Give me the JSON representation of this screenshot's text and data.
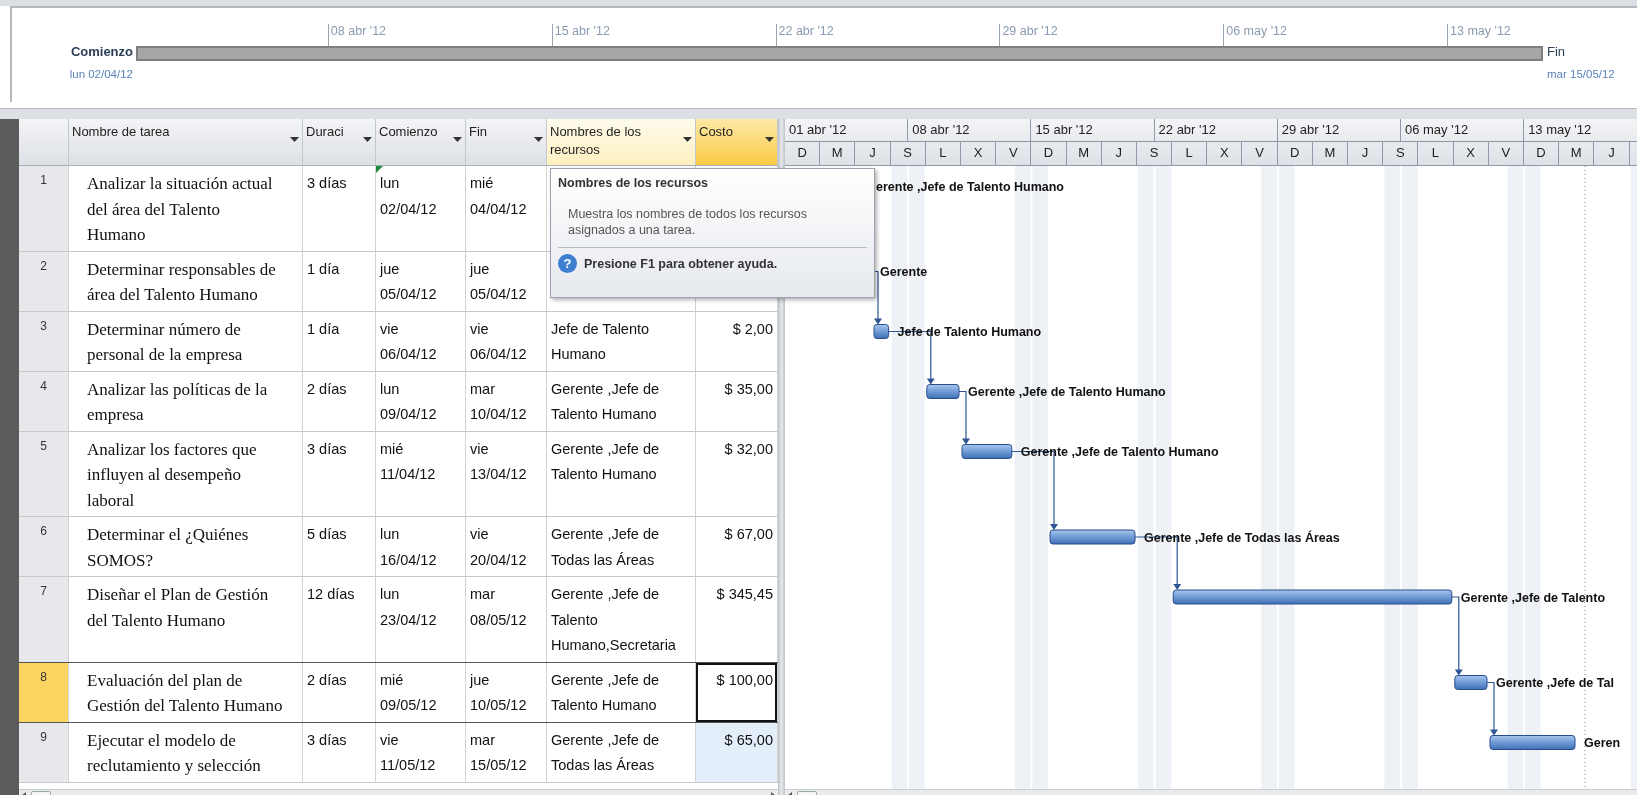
{
  "timeline": {
    "start_label": "Comienzo",
    "start_date": "lun 02/04/12",
    "end_label": "Fin",
    "end_date": "mar 15/05/12",
    "ticks": [
      "08 abr '12",
      "15 abr '12",
      "22 abr '12",
      "29 abr '12",
      "06 may '12",
      "13 may '12"
    ]
  },
  "table": {
    "columns": [
      {
        "label": "Nombre de tarea",
        "selected": false,
        "hovered": false
      },
      {
        "label": "Duraci",
        "selected": false,
        "hovered": false
      },
      {
        "label": "Comienzo",
        "selected": false,
        "hovered": false
      },
      {
        "label": "Fin",
        "selected": false,
        "hovered": false
      },
      {
        "label": "Nombres de los recursos",
        "selected": false,
        "hovered": true
      },
      {
        "label": "Costo",
        "selected": true,
        "hovered": false
      }
    ],
    "rows": [
      {
        "id": "1",
        "name": "Analizar la situación actual\ndel área del Talento\nHumano",
        "duration": "3 días",
        "start": "lun 02/04/12",
        "finish": "mié 04/04/12",
        "start_flag": true,
        "selected": false,
        "cost_active": false,
        "cost_highlighted": false,
        "bar_label": "erente ,Jefe de Talento Humano"
      },
      {
        "id": "2",
        "name": "Determinar responsables de\nárea del Talento Humano",
        "duration": "1 día",
        "start": "jue 05/04/12",
        "finish": "jue 05/04/12",
        "start_flag": false,
        "selected": false,
        "cost_active": false,
        "cost_highlighted": false,
        "bar_label": "Gerente"
      },
      {
        "id": "3",
        "name": "Determinar número de\npersonal de la empresa",
        "duration": "1 día",
        "start": "vie 06/04/12",
        "finish": "vie 06/04/12",
        "resources": "Jefe de Talento Humano",
        "cost": "$ 2,00",
        "start_flag": false,
        "selected": false,
        "cost_active": false,
        "cost_highlighted": false,
        "bar_label": "Jefe de Talento Humano"
      },
      {
        "id": "4",
        "name": "Analizar las políticas de la\nempresa",
        "duration": "2 días",
        "start": "lun 09/04/12",
        "finish": "mar 10/04/12",
        "resources": "Gerente ,Jefe de Talento Humano",
        "cost": "$ 35,00",
        "start_flag": false,
        "selected": false,
        "cost_active": false,
        "cost_highlighted": false,
        "bar_label": "Gerente ,Jefe de Talento Humano"
      },
      {
        "id": "5",
        "name": "Analizar los factores que\ninfluyen al desempeño\nlaboral",
        "duration": "3 días",
        "start": "mié 11/04/12",
        "finish": "vie 13/04/12",
        "resources": "Gerente ,Jefe de Talento Humano",
        "cost": "$ 32,00",
        "start_flag": false,
        "selected": false,
        "cost_active": false,
        "cost_highlighted": false,
        "bar_label": "Gerente ,Jefe de Talento Humano"
      },
      {
        "id": "6",
        "name": "Determinar el ¿Quiénes\nSOMOS?",
        "duration": "5 días",
        "start": "lun 16/04/12",
        "finish": "vie 20/04/12",
        "resources": "Gerente ,Jefe de Todas las Áreas",
        "cost": "$ 67,00",
        "start_flag": false,
        "selected": false,
        "cost_active": false,
        "cost_highlighted": false,
        "bar_label": "Gerente ,Jefe de Todas las Áreas"
      },
      {
        "id": "7",
        "name": "Diseñar el Plan de Gestión\ndel Talento Humano",
        "duration": "12 días",
        "start": "lun 23/04/12",
        "finish": "mar 08/05/12",
        "resources": "Gerente ,Jefe de Talento Humano,Secretaria",
        "cost": "$ 345,45",
        "start_flag": false,
        "selected": false,
        "cost_active": false,
        "cost_highlighted": false,
        "bar_label": "Gerente ,Jefe de Talento"
      },
      {
        "id": "8",
        "name": "Evaluación del plan de\nGestión del Talento Humano",
        "duration": "2 días",
        "start": "mié 09/05/12",
        "finish": "jue 10/05/12",
        "resources": "Gerente ,Jefe de Talento Humano",
        "cost": "$ 100,00",
        "start_flag": false,
        "selected": true,
        "cost_active": true,
        "cost_highlighted": false,
        "bar_label": "Gerente ,Jefe de Tal"
      },
      {
        "id": "9",
        "name": "Ejecutar el modelo de\nreclutamiento y selección",
        "duration": "3 días",
        "start": "vie 11/05/12",
        "finish": "mar 15/05/12",
        "resources": "Gerente ,Jefe de Todas las Áreas",
        "cost": "$ 65,00",
        "start_flag": false,
        "selected": false,
        "cost_active": false,
        "cost_highlighted": true,
        "bar_label": "Geren"
      }
    ]
  },
  "gantt": {
    "weeks": [
      "01 abr '12",
      "08 abr '12",
      "15 abr '12",
      "22 abr '12",
      "29 abr '12",
      "06 may '12",
      "13 may '12"
    ],
    "days": [
      "D",
      "M",
      "J",
      "S",
      "L",
      "X",
      "V",
      "D",
      "M",
      "J",
      "S",
      "L",
      "X",
      "V",
      "D",
      "M",
      "J",
      "S",
      "L",
      "X",
      "V",
      "D",
      "M",
      "J"
    ]
  },
  "tooltip": {
    "title": "Nombres de los recursos",
    "text": "Muestra los nombres de todos los recursos asignados a una tarea.",
    "help_icon": "?",
    "help": "Presione F1 para obtener ayuda."
  }
}
